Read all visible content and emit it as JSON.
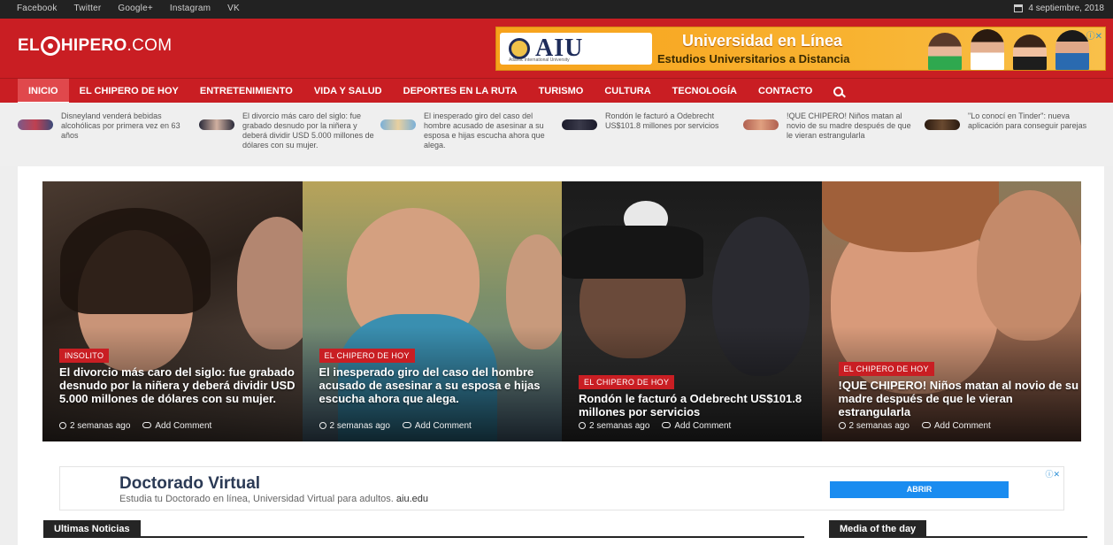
{
  "topbar": {
    "social": [
      "Facebook",
      "Twitter",
      "Google+",
      "Instagram",
      "VK"
    ],
    "date": "4 septiembre, 2018"
  },
  "header": {
    "logo_pre": "EL",
    "logo_main": "HIPERO",
    "logo_suffix": ".COM",
    "ad": {
      "brand": "AIU",
      "brand_sub": "Atlantic International University",
      "line1": "Universidad en Línea",
      "line2": "Estudios Universitarios a Distancia"
    }
  },
  "nav": {
    "items": [
      "INICIO",
      "EL CHIPERO DE HOY",
      "ENTRETENIMIENTO",
      "VIDA Y SALUD",
      "DEPORTES EN LA RUTA",
      "TURISMO",
      "CULTURA",
      "TECNOLOGÍA",
      "CONTACTO"
    ],
    "active": "INICIO"
  },
  "ticker": [
    {
      "text": "Disneyland venderá bebidas alcohólicas por primera vez en 63 años"
    },
    {
      "text": "El divorcio más caro del siglo: fue grabado desnudo por la niñera y deberá dividir USD 5.000 millones de dólares con su mujer."
    },
    {
      "text": "El inesperado giro del caso del hombre acusado de asesinar a su esposa e hijas escucha ahora que alega."
    },
    {
      "text": "Rondón le facturó a Odebrecht US$101.8 millones por servicios"
    },
    {
      "text": "!QUE CHIPERO! Niños matan al novio de su madre después de que le vieran estrangularla"
    },
    {
      "text": "\"Lo conocí en Tinder\": nueva aplicación para conseguir parejas"
    }
  ],
  "slides": [
    {
      "category": "INSOLITO",
      "title": "El divorcio más caro del siglo: fue grabado desnudo por la niñera y deberá dividir USD 5.000 millones de dólares con su mujer.",
      "time": "2 semanas ago",
      "comment": "Add Comment"
    },
    {
      "category": "EL CHIPERO DE HOY",
      "title": "El inesperado giro del caso del hombre acusado de asesinar a su esposa e hijas escucha ahora que alega.",
      "time": "2 semanas ago",
      "comment": "Add Comment"
    },
    {
      "category": "EL CHIPERO DE HOY",
      "title": "Rondón le facturó a Odebrecht US$101.8 millones por servicios",
      "time": "2 semanas ago",
      "comment": "Add Comment"
    },
    {
      "category": "EL CHIPERO DE HOY",
      "title": "!QUE CHIPERO! Niños matan al novio de su madre después de que le vieran estrangularla",
      "time": "2 semanas ago",
      "comment": "Add Comment"
    }
  ],
  "ad2": {
    "title": "Doctorado Virtual",
    "desc": "Estudia tu Doctorado en línea, Universidad Virtual para adultos.",
    "domain": "aiu.edu",
    "button": "ABRIR"
  },
  "sections": {
    "latest": "Ultimas Noticias",
    "media": "Media of the day"
  },
  "colors": {
    "brand_red": "#c91e23",
    "topbar": "#222222",
    "ad_button": "#1a8cf0"
  }
}
